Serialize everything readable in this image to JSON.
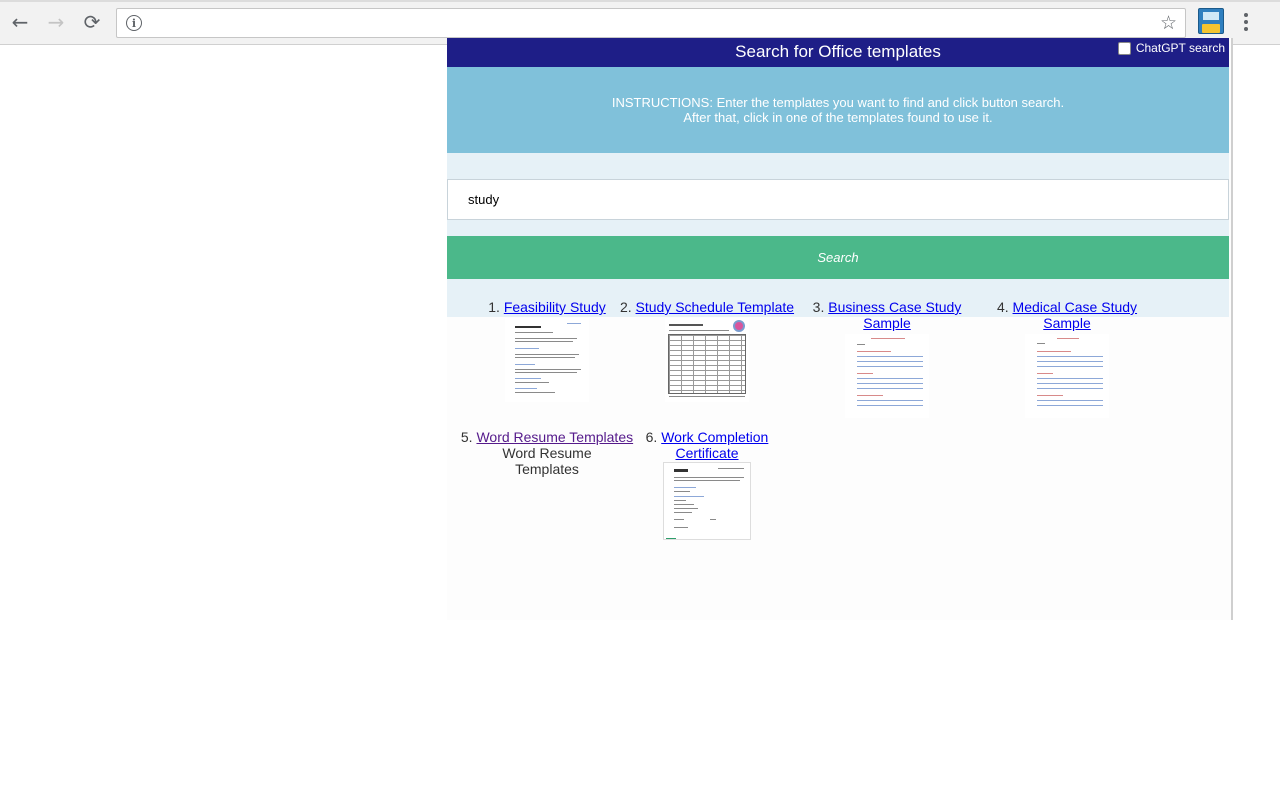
{
  "browser": {
    "url": "",
    "back_glyph": "←",
    "forward_glyph": "→",
    "reload_glyph": "⟳",
    "info_glyph": "i",
    "star_glyph": "☆"
  },
  "panel": {
    "title": "Search for Office templates",
    "chatgpt_label": "ChatGPT search",
    "instructions_line1": "INSTRUCTIONS: Enter the templates you want to find and click button search.",
    "instructions_line2": "After that, click in one of the templates found to use it.",
    "search_value": "study",
    "search_button": "Search"
  },
  "results": [
    {
      "index": "1.",
      "title": "Feasibility Study"
    },
    {
      "index": "2.",
      "title": "Study Schedule Template"
    },
    {
      "index": "3.",
      "title": "Business Case Study Sample"
    },
    {
      "index": "4.",
      "title": "Medical Case Study Sample"
    },
    {
      "index": "5.",
      "title": "Word Resume Templates",
      "alt": "Word Resume Templates"
    },
    {
      "index": "6.",
      "title": "Work Completion Certificate"
    }
  ],
  "colors": {
    "header": "#1e1e87",
    "instructions": "#80c1da",
    "search_button": "#4bb88a",
    "link": "#0000ee",
    "visited_link": "#551a8b"
  }
}
